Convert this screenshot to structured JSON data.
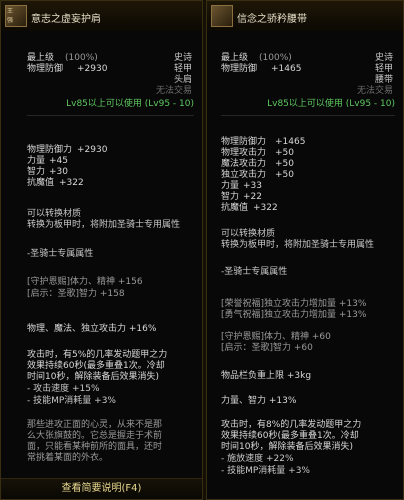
{
  "left": {
    "icon_caption": "王\n强",
    "title": "意志之虚妄护肩",
    "rarity": "史诗",
    "level_max": "最上级",
    "level_pct": "(100%)",
    "armor_type": "轻甲",
    "slot": "头肩",
    "phys_def_label": "物理防御",
    "phys_def_value": "+2930",
    "trade": "无法交易",
    "use_req": "Lv85以上可以使用 (Lv95 - 10)",
    "stats": [
      {
        "label": "物理防御力",
        "value": "+2930"
      },
      {
        "label": "力量",
        "value": "+45"
      },
      {
        "label": "智力",
        "value": "+30"
      },
      {
        "label": "抗魔值",
        "value": "+322"
      }
    ],
    "convert_1": "可以转换材质",
    "convert_2": "转换为板甲时，将附加圣骑士专用属性",
    "paladin_title": "-圣骑士专属属性",
    "paladin_1": "[守护恩赐]体力、精神 +156",
    "paladin_2": "[启示：圣歌]智力 +158",
    "attack_line": "物理、魔法、独立攻击力 +16%",
    "proc_1": "攻击时，有5%的几率发动题甲之力",
    "proc_2": "效果持续60秒(最多重叠1次。冷却",
    "proc_3": "时间10秒，解除装备后效果消失)",
    "proc_4": "- 攻击速度 +15%",
    "proc_5": "- 技能MP消耗量 +3%",
    "flavor_1": "那些进攻正面的心灵，从来不是那",
    "flavor_2": "么大张旗鼓的。它总是握走于术前",
    "flavor_3": "面，只能看某种前所的面具，还时",
    "flavor_4": "常挑着某面的外衣。",
    "button": "查看简要说明(F4)"
  },
  "right": {
    "icon_caption": "",
    "title": "信念之骄矜腰带",
    "rarity": "史诗",
    "level_max": "最上级",
    "level_pct": "(100%)",
    "armor_type": "轻甲",
    "slot": "腰带",
    "phys_def_label": "物理防御",
    "phys_def_value": "+1465",
    "trade": "无法交易",
    "use_req": "Lv85以上可以使用 (Lv95 - 10)",
    "stats": [
      {
        "label": "物理防御力",
        "value": "+1465"
      },
      {
        "label": "物理攻击力",
        "value": "+50"
      },
      {
        "label": "魔法攻击力",
        "value": "+50"
      },
      {
        "label": "独立攻击力",
        "value": "+50"
      },
      {
        "label": "力量",
        "value": "+33"
      },
      {
        "label": "智力",
        "value": "+22"
      },
      {
        "label": "抗魔值",
        "value": "+322"
      }
    ],
    "convert_1": "可以转换材质",
    "convert_2": "转换为板甲时，将附加圣骑士专用属性",
    "paladin_title": "-圣骑士专属属性",
    "paladin_1": "[荣誉祝福]独立攻击力增加量 +13%",
    "paladin_2": "[勇气祝福]独立攻击力增加量 +13%",
    "paladin_3": "[守护恩赐]体力、精神 +60",
    "paladin_4": "[启示：圣歌]智力 +60",
    "weight": "物品栏负重上限 +3kg",
    "strint": "力量、智力 +13%",
    "proc_1": "攻击时，有8%的几率发动题甲之力",
    "proc_2": "效果持续60秒(最多重叠1次。冷却",
    "proc_3": "时间10秒，解除装备后效果消失)",
    "proc_4": "- 施放速度 +22%",
    "proc_5": "- 技能MP消耗量 +3%"
  }
}
